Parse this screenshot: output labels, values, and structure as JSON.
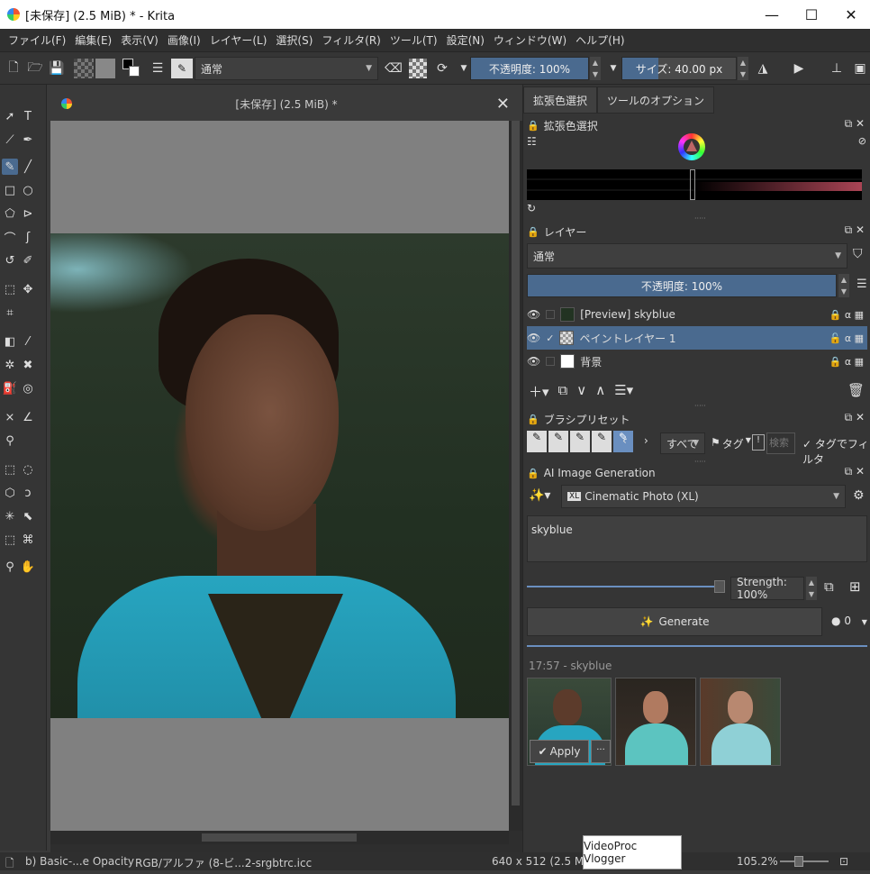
{
  "window": {
    "title": "[未保存]  (2.5 MiB) * - Krita",
    "minimize_icon": "minimize-icon",
    "maximize_icon": "maximize-icon",
    "close_icon": "close-icon"
  },
  "menu": [
    "ファイル(F)",
    "編集(E)",
    "表示(V)",
    "画像(I)",
    "レイヤー(L)",
    "選択(S)",
    "フィルタ(R)",
    "ツール(T)",
    "設定(N)",
    "ウィンドウ(W)",
    "ヘルプ(H)"
  ],
  "toolbar": {
    "blend_mode": "通常",
    "opacity_label": "不透明度: 100%",
    "opacity_value": 1.0,
    "size_label": "サイズ: 40.00 px"
  },
  "document": {
    "tab_title": "[未保存]  (2.5 MiB) *",
    "close_glyph": "✕"
  },
  "dock": {
    "tabs": [
      "拡張色選択",
      "ツールのオプション"
    ],
    "color_selector": {
      "title": "拡張色選択"
    },
    "layers": {
      "title": "レイヤー",
      "blend_mode": "通常",
      "opacity_label": "不透明度: 100%",
      "items": [
        {
          "name": "[Preview] skyblue",
          "visible": true,
          "checked": false
        },
        {
          "name": "ペイントレイヤー 1",
          "visible": true,
          "checked": true
        },
        {
          "name": "背景",
          "visible": true,
          "checked": false
        }
      ]
    },
    "brush_presets": {
      "title": "ブラシプリセット",
      "filter": "すべて",
      "tag_label": "タグ",
      "search_placeholder": "検索",
      "tag_filter_label": "タグでフィルタ"
    },
    "ai": {
      "title": "AI Image Generation",
      "model": "Cinematic Photo (XL)",
      "prompt": "skyblue",
      "strength_label": "Strength: 100%",
      "strength_value": 1.0,
      "generate_label": "Generate",
      "queue_count": "0",
      "history_label": "17:57 - skyblue",
      "apply_label": "Apply",
      "more_label": "···"
    }
  },
  "status": {
    "brush": "b) Basic-...e Opacity",
    "color_profile": "RGB/アルファ (8-ビ...2-srgbtrc.icc",
    "dimensions": "640 x 512 (2.5 MiB)",
    "zoom": "105.2%"
  },
  "tooltip": "VideoProc Vlogger",
  "colors": {
    "accent": "#4a6a8f",
    "background": "#353535",
    "canvas_bg": "#808080"
  }
}
